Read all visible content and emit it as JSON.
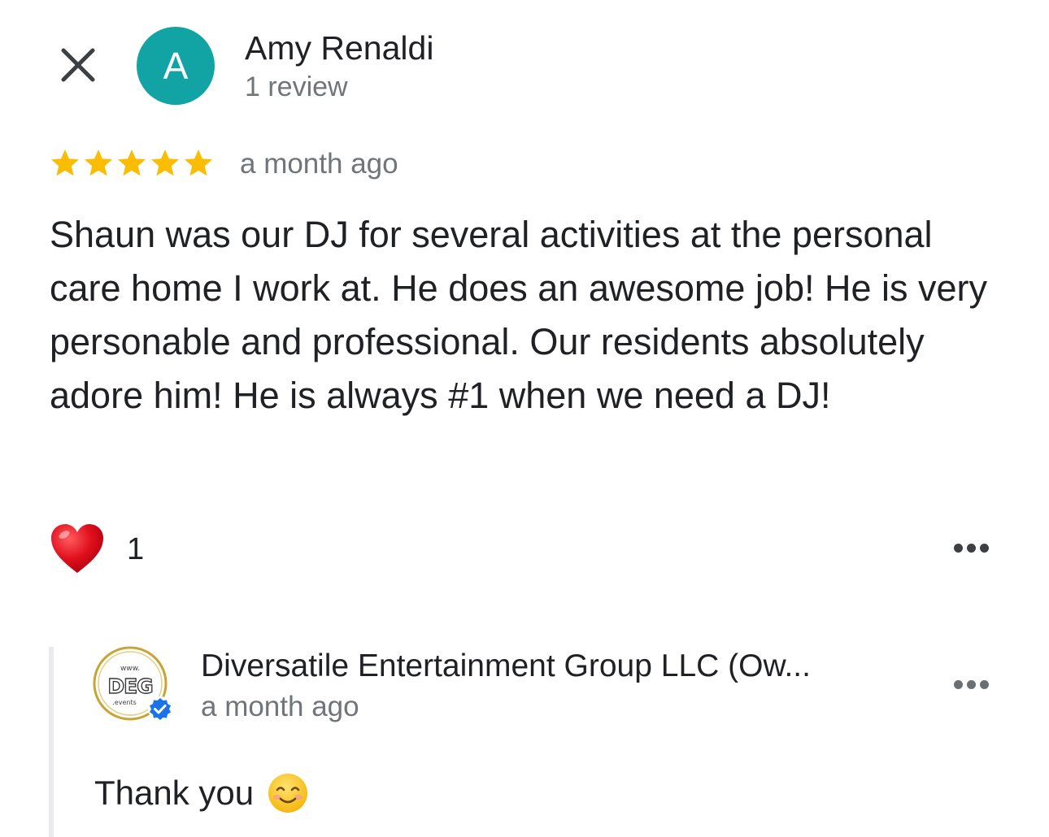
{
  "reviewer": {
    "avatar_letter": "A",
    "avatar_color": "#12a4a4",
    "name": "Amy Renaldi",
    "review_count": "1 review"
  },
  "review": {
    "rating": 5,
    "rating_max": 5,
    "star_color": "#fbbc04",
    "time": "a month ago",
    "text": "Shaun was our DJ for several activities at the personal care home I work at. He does an awesome job! He is very personable and professional. Our residents absolutely adore him! He is always #1 when we need a DJ!"
  },
  "reactions": {
    "icon": "red-heart-icon",
    "heart_color": "#e0101c",
    "count": "1"
  },
  "owner_reply": {
    "name": "Diversatile Entertainment Group LLC (Ow...",
    "time": "a month ago",
    "logo": {
      "top_text": "www.",
      "main_text": "DEG",
      "bottom_text": ".events",
      "ring_color": "#c8a437",
      "verified_color": "#1a73e8"
    },
    "text": "Thank you",
    "emoji": "smiling-face-icon"
  },
  "icons": {
    "close": "close-icon",
    "more": "more-horizontal-icon",
    "more_color": "#3c4043"
  }
}
